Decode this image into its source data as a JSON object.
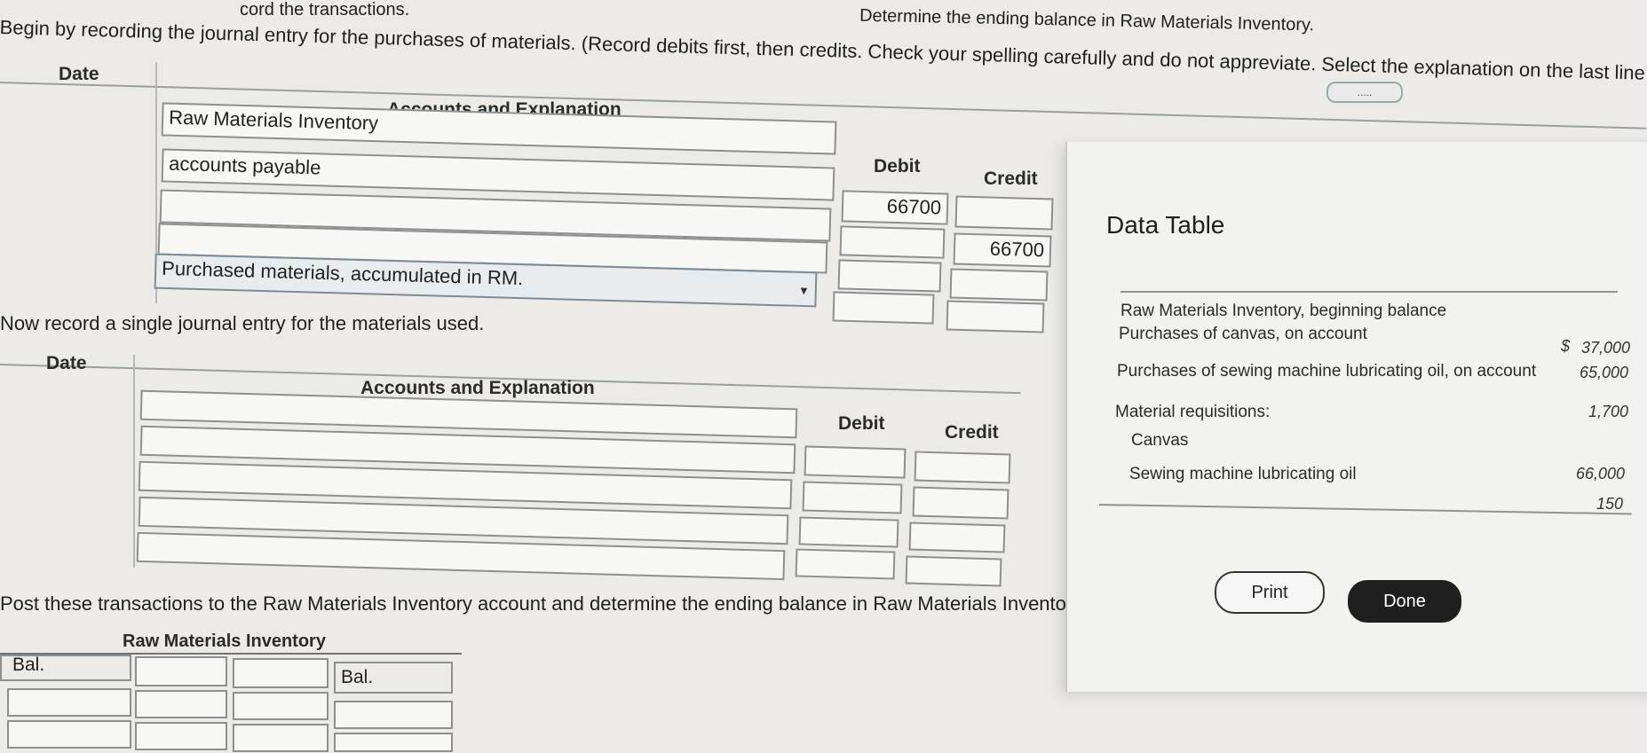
{
  "top": {
    "fragment_left": "cord the transactions.",
    "fragment_right": "Determine the ending balance in Raw Materials Inventory.",
    "more_button": "....."
  },
  "instructions": {
    "purchases": "Begin by recording the journal entry for the purchases of materials. (Record debits first, then credits. Check your spelling carefully and do not appreviate. Select the explanation on the last line of the journal e",
    "materials_used": "Now record a single journal entry for the materials used.",
    "post": "Post these transactions to the Raw Materials Inventory account and determine the ending balance in Raw Materials Invento"
  },
  "journal1": {
    "headers": {
      "date": "Date",
      "accounts": "Accounts and Explanation",
      "debit": "Debit",
      "credit": "Credit"
    },
    "rows": [
      {
        "account": "Raw Materials Inventory",
        "debit": "66700",
        "credit": ""
      },
      {
        "account": "accounts payable",
        "debit": "",
        "credit": "66700"
      },
      {
        "account": "",
        "debit": "",
        "credit": ""
      },
      {
        "account": "",
        "debit": "",
        "credit": ""
      }
    ],
    "explanation": "Purchased materials, accumulated in RM."
  },
  "journal2": {
    "headers": {
      "date": "Date",
      "accounts": "Accounts and Explanation",
      "debit": "Debit",
      "credit": "Credit"
    }
  },
  "t_account": {
    "title": "Raw Materials Inventory",
    "left_bal_label": "Bal.",
    "right_bal_label": "Bal."
  },
  "data_table": {
    "title": "Data Table",
    "rows": [
      {
        "label": "Raw Materials Inventory, beginning balance",
        "currency": "$",
        "value": "37,000"
      },
      {
        "label": "Purchases of canvas, on account",
        "currency": "",
        "value": "65,000"
      },
      {
        "label": "Purchases of sewing machine lubricating oil, on account",
        "currency": "",
        "value": "1,700"
      },
      {
        "label": "Material requisitions:",
        "currency": "",
        "value": ""
      },
      {
        "label": "Canvas",
        "currency": "",
        "value": "66,000"
      },
      {
        "label": "Sewing machine lubricating oil",
        "currency": "",
        "value": "150"
      }
    ],
    "print_label": "Print",
    "done_label": "Done"
  }
}
